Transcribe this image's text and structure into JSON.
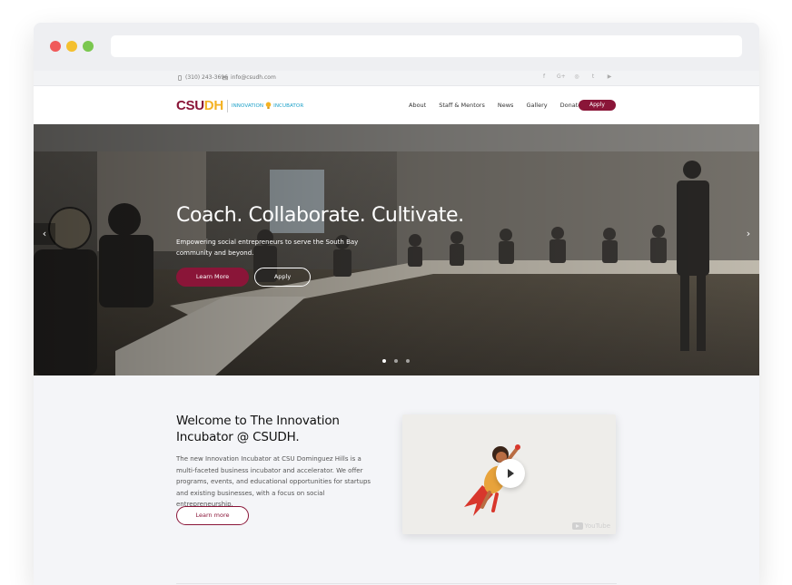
{
  "topbar": {
    "phone": "(310) 243-3696",
    "email": "info@csudh.com",
    "socials": [
      "f",
      "G+",
      "◎",
      "t",
      "▶"
    ]
  },
  "logo": {
    "csu": "CSU",
    "dh": "DH",
    "innovation": "INNOVATION",
    "incubator": "INCUBATOR"
  },
  "nav": {
    "items": [
      "About",
      "Staff & Mentors",
      "News",
      "Gallery",
      "Donate"
    ],
    "apply": "Apply"
  },
  "hero": {
    "title": "Coach. Collaborate. Cultivate.",
    "subtitle": "Empowering social entrepreneurs to serve the South Bay community and beyond.",
    "learn_more": "Learn More",
    "apply": "Apply",
    "prev": "‹",
    "next": "›",
    "slides": 3,
    "active_slide": 1
  },
  "welcome": {
    "heading": "Welcome to The Innovation Incubator @ CSUDH.",
    "body": "The new Innovation Incubator at CSU Dominguez Hills is a multi-faceted business incubator and accelerator. We offer programs, events, and educational opportunities for startups and existing businesses, with a focus on social entrepreneurship.",
    "button": "Learn more"
  },
  "video": {
    "provider": "YouTube"
  },
  "colors": {
    "brand": "#8a1538",
    "gold": "#f4b223",
    "accent": "#1aa0c8"
  }
}
